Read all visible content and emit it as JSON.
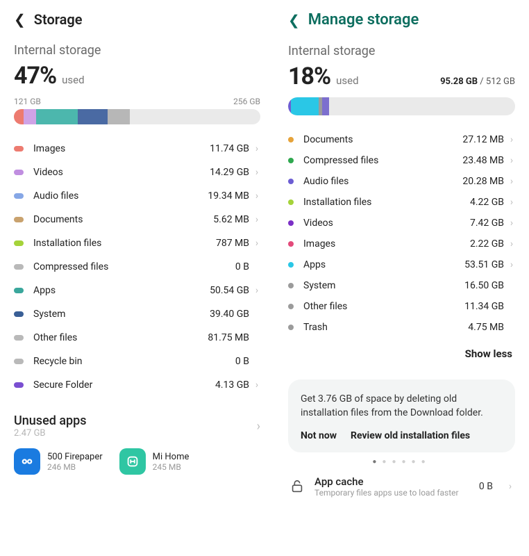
{
  "left": {
    "title": "Storage",
    "subhead": "Internal storage",
    "percent": "47%",
    "percent_label": "used",
    "used_gb": "121 GB",
    "total_gb": "256 GB",
    "bar_segments": [
      {
        "color": "#ed7b70",
        "pct": 4
      },
      {
        "color": "#cfa3e6",
        "pct": 5
      },
      {
        "color": "#4cb7ad",
        "pct": 17
      },
      {
        "color": "#4a6aa3",
        "pct": 12
      },
      {
        "color": "#b7b7b7",
        "pct": 9
      }
    ],
    "rows": [
      {
        "color": "#ed7b70",
        "label": "Images",
        "value": "11.74 GB",
        "nav": true
      },
      {
        "color": "#c08ee0",
        "label": "Videos",
        "value": "14.29 GB",
        "nav": true
      },
      {
        "color": "#86a7e6",
        "label": "Audio files",
        "value": "19.34 MB",
        "nav": true
      },
      {
        "color": "#c9a26e",
        "label": "Documents",
        "value": "5.62 MB",
        "nav": true
      },
      {
        "color": "#a5d33a",
        "label": "Installation files",
        "value": "787 MB",
        "nav": true
      },
      {
        "color": "#b9b9b9",
        "label": "Compressed files",
        "value": "0 B",
        "nav": false
      },
      {
        "color": "#3aa79c",
        "label": "Apps",
        "value": "50.54 GB",
        "nav": true
      },
      {
        "color": "#3a5f96",
        "label": "System",
        "value": "39.40 GB",
        "nav": false
      },
      {
        "color": "#b9b9b9",
        "label": "Other files",
        "value": "81.75 MB",
        "nav": false
      },
      {
        "color": "#b9b9b9",
        "label": "Recycle bin",
        "value": "0 B",
        "nav": false
      },
      {
        "color": "#7a4fd1",
        "label": "Secure Folder",
        "value": "4.13 GB",
        "nav": true
      }
    ],
    "unused": {
      "title": "Unused apps",
      "subtitle": "2.47 GB",
      "apps": [
        {
          "name": "500 Firepaper",
          "size": "246 MB",
          "bg": "#1a7be0",
          "icon": "eyes"
        },
        {
          "name": "Mi Home",
          "size": "245 MB",
          "bg": "#2fc6a3",
          "icon": "mi"
        }
      ]
    }
  },
  "right": {
    "title": "Manage storage",
    "subhead": "Internal storage",
    "percent": "18%",
    "percent_label": "used",
    "used_gb": "95.28 GB",
    "total_gb": "512 GB",
    "bar_segments": [
      {
        "color": "#6c5dd3",
        "pct": 6
      },
      {
        "color": "#2ac7e6",
        "pct": 68
      },
      {
        "color": "#9b9b9b",
        "pct": 10
      },
      {
        "color": "#7c6fce",
        "pct": 16
      }
    ],
    "rows": [
      {
        "color": "#e6a33a",
        "label": "Documents",
        "value": "27.12 MB",
        "nav": true
      },
      {
        "color": "#2fa84f",
        "label": "Compressed files",
        "value": "23.48 MB",
        "nav": true
      },
      {
        "color": "#6c5dd3",
        "label": "Audio files",
        "value": "20.28 MB",
        "nav": true
      },
      {
        "color": "#a5d33a",
        "label": "Installation files",
        "value": "4.22 GB",
        "nav": true
      },
      {
        "color": "#7b2fc6",
        "label": "Videos",
        "value": "7.42 GB",
        "nav": true
      },
      {
        "color": "#e34a7a",
        "label": "Images",
        "value": "2.22 GB",
        "nav": true
      },
      {
        "color": "#2ac7e6",
        "label": "Apps",
        "value": "53.51 GB",
        "nav": true
      },
      {
        "color": "#9b9b9b",
        "label": "System",
        "value": "16.50 GB",
        "nav": false
      },
      {
        "color": "#9b9b9b",
        "label": "Other files",
        "value": "11.34 GB",
        "nav": false
      },
      {
        "color": "#9b9b9b",
        "label": "Trash",
        "value": "4.75 MB",
        "nav": false
      }
    ],
    "show_less": "Show less",
    "card": {
      "msg": "Get 3.76 GB of space by deleting old installation files from the Download folder.",
      "not_now": "Not now",
      "review": "Review old installation files"
    },
    "cache": {
      "title": "App cache",
      "subtitle": "Temporary files apps use to load faster",
      "value": "0 B"
    }
  }
}
